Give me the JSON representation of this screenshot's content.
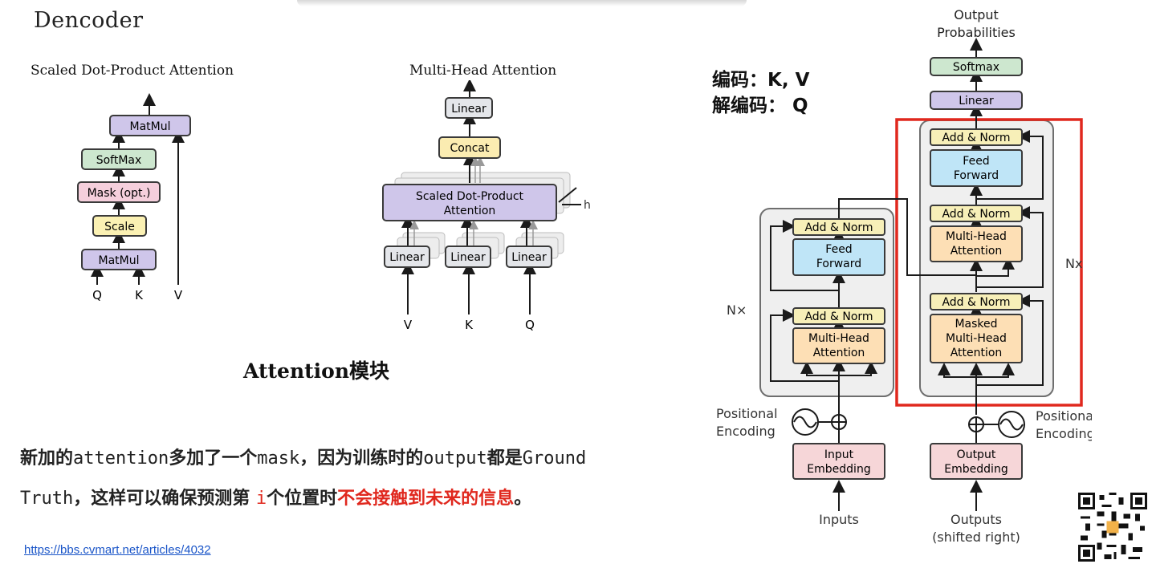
{
  "slide": {
    "title": "Dencoder"
  },
  "scaled_dot": {
    "heading": "Scaled Dot-Product Attention",
    "matmul_top": "MatMul",
    "softmax": "SoftMax",
    "mask": "Mask (opt.)",
    "scale": "Scale",
    "matmul_bottom": "MatMul",
    "input_q": "Q",
    "input_k": "K",
    "input_v": "V"
  },
  "multi_head": {
    "heading": "Multi-Head Attention",
    "linear_top": "Linear",
    "concat": "Concat",
    "sdpa_line1": "Scaled Dot-Product",
    "sdpa_line2": "Attention",
    "h_label": "h",
    "linear_v": "Linear",
    "linear_k": "Linear",
    "linear_q": "Linear",
    "input_v": "V",
    "input_k": "K",
    "input_q": "Q"
  },
  "section_caption": "Attention模块",
  "note": {
    "line1": "编码：K, V",
    "line2": "解编码： Q"
  },
  "body": {
    "l1_a": "新加的",
    "l1_b": "attention",
    "l1_c": "多加了一个",
    "l1_d": "mask",
    "l1_e": "，因为训练时的",
    "l1_f": "output",
    "l1_g": "都是",
    "l1_h": "Ground",
    "l2_a": "Truth",
    "l2_b": "，这样可以确保预测第 ",
    "l2_c": "i",
    "l2_d": "个位置时",
    "l2_e": "不会接触到未来的信息",
    "l2_f": "。"
  },
  "link": "https://bbs.cvmart.net/articles/4032",
  "transformer": {
    "output_line1": "Output",
    "output_line2": "Probabilities",
    "softmax": "Softmax",
    "linear": "Linear",
    "dec_addnorm_top": "Add & Norm",
    "dec_ff_line1": "Feed",
    "dec_ff_line2": "Forward",
    "dec_addnorm_mid": "Add & Norm",
    "dec_mha_line1": "Multi-Head",
    "dec_mha_line2": "Attention",
    "dec_addnorm_low": "Add & Norm",
    "dec_masked_line1": "Masked",
    "dec_masked_line2": "Multi-Head",
    "dec_masked_line3": "Attention",
    "dec_nx": "Nx",
    "enc_addnorm_top": "Add & Norm",
    "enc_ff_line1": "Feed",
    "enc_ff_line2": "Forward",
    "enc_addnorm_low": "Add & Norm",
    "enc_mha_line1": "Multi-Head",
    "enc_mha_line2": "Attention",
    "enc_nx": "N×",
    "pos_enc_left_1": "Positional",
    "pos_enc_left_2": "Encoding",
    "pos_enc_right_1": "Positional",
    "pos_enc_right_2": "Encoding",
    "input_emb_1": "Input",
    "input_emb_2": "Embedding",
    "output_emb_1": "Output",
    "output_emb_2": "Embedding",
    "inputs": "Inputs",
    "outputs_1": "Outputs",
    "outputs_2": "(shifted right)"
  },
  "colors": {
    "matmul": "#cfc6ea",
    "softmax": "#cde7cf",
    "mask": "#f5cfdc",
    "scale": "#fbf1b3",
    "linear": "#e4e6ea",
    "concat": "#fbecb1",
    "attention": "#fddfb5",
    "feedforward": "#bfe5f7",
    "addnorm": "#f7efb8",
    "embedding": "#f6d6d8",
    "highlight_red": "#e0281e",
    "box_stroke": "#3a3a3a"
  }
}
